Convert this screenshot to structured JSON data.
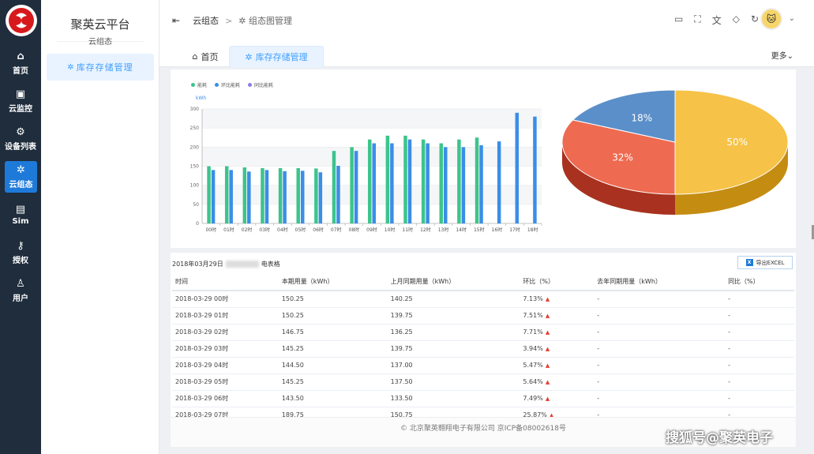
{
  "rail": {
    "items": [
      {
        "label": "首页",
        "icon": "home-icon",
        "glyph": "⌂"
      },
      {
        "label": "云监控",
        "icon": "monitor-icon",
        "glyph": "▣"
      },
      {
        "label": "设备列表",
        "icon": "gear-icon",
        "glyph": "⚙"
      },
      {
        "label": "云组态",
        "icon": "nodes-icon",
        "glyph": "✲"
      },
      {
        "label": "Sim",
        "icon": "sim-icon",
        "glyph": "▤"
      },
      {
        "label": "授权",
        "icon": "key-icon",
        "glyph": "⚷"
      },
      {
        "label": "用户",
        "icon": "user-icon",
        "glyph": "♙"
      }
    ],
    "active_index": 3
  },
  "sidebar": {
    "title": "聚英云平台",
    "subtitle": "云组态",
    "item": "库存存储管理"
  },
  "header": {
    "breadcrumb_root": "云组态",
    "breadcrumb_sep": ">",
    "breadcrumb_current": "组态图管理",
    "icons": [
      "monitor-icon",
      "fullscreen-icon",
      "translate-icon",
      "skin-icon",
      "refresh-icon"
    ]
  },
  "tabs": {
    "home": "首页",
    "active": "库存存储管理",
    "more": "更多"
  },
  "colors": {
    "accent": "#409eff",
    "bar_green": "#3cc48c",
    "bar_blue": "#3a8ee6",
    "pie_yellow": "#f6c247",
    "pie_red": "#ee6a50",
    "pie_blue": "#5b8fc9",
    "rail": "#1f2d3d"
  },
  "chart_data": [
    {
      "type": "bar",
      "legend": [
        "能耗",
        "环比能耗",
        "同比能耗"
      ],
      "unit": "kWh",
      "categories": [
        "00时",
        "01时",
        "02时",
        "03时",
        "04时",
        "05时",
        "06时",
        "07时",
        "08时",
        "09时",
        "10时",
        "11时",
        "12时",
        "13时",
        "14时",
        "15时",
        "16时",
        "17时",
        "18时"
      ],
      "yticks": [
        0,
        50,
        100,
        150,
        200,
        250,
        300
      ],
      "ylim": [
        0,
        300
      ],
      "series": [
        {
          "name": "能耗",
          "values": [
            150,
            150,
            147,
            145,
            145,
            145,
            144,
            190,
            200,
            220,
            230,
            230,
            220,
            210,
            220,
            225,
            null,
            null,
            null
          ]
        },
        {
          "name": "环比能耗",
          "values": [
            140,
            140,
            136,
            140,
            137,
            138,
            134,
            151,
            190,
            210,
            210,
            220,
            210,
            200,
            200,
            205,
            215,
            290,
            280
          ]
        },
        {
          "name": "同比能耗",
          "values": []
        }
      ],
      "legend_position": "top-left",
      "grid": true
    },
    {
      "type": "pie",
      "slices": [
        {
          "label": "50%",
          "value": 50
        },
        {
          "label": "32%",
          "value": 32
        },
        {
          "label": "18%",
          "value": 18
        }
      ]
    }
  ],
  "table": {
    "caption_date": "2018年03月29日",
    "caption_suffix": "电表格",
    "export_label": "导出EXCEL",
    "headers": [
      "时间",
      "本期用量（kWh）",
      "上月同期用量（kWh）",
      "环比（%）",
      "去年同期用量（kWh）",
      "同比（%）"
    ],
    "rows": [
      [
        "2018-03-29 00时",
        "150.25",
        "140.25",
        "7.13%",
        "-",
        "-"
      ],
      [
        "2018-03-29 01时",
        "150.25",
        "139.75",
        "7.51%",
        "-",
        "-"
      ],
      [
        "2018-03-29 02时",
        "146.75",
        "136.25",
        "7.71%",
        "-",
        "-"
      ],
      [
        "2018-03-29 03时",
        "145.25",
        "139.75",
        "3.94%",
        "-",
        "-"
      ],
      [
        "2018-03-29 04时",
        "144.50",
        "137.00",
        "5.47%",
        "-",
        "-"
      ],
      [
        "2018-03-29 05时",
        "145.25",
        "137.50",
        "5.64%",
        "-",
        "-"
      ],
      [
        "2018-03-29 06时",
        "143.50",
        "133.50",
        "7.49%",
        "-",
        "-"
      ],
      [
        "2018-03-29 07时",
        "189.75",
        "150.75",
        "25.87%",
        "-",
        "-"
      ]
    ]
  },
  "footer": "© 北京聚英翱翔电子有限公司 京ICP备08002618号",
  "watermark": "搜狐号@聚英电子"
}
